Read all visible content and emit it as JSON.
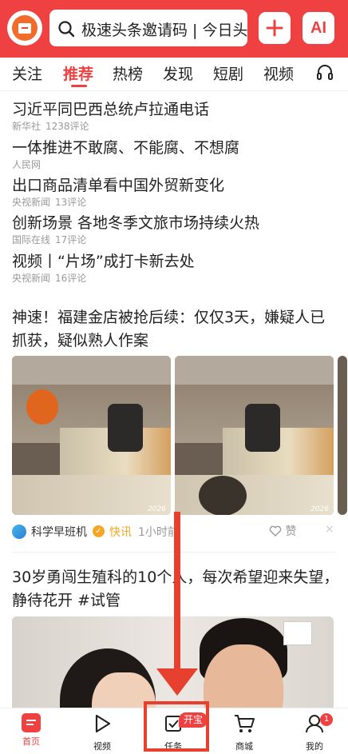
{
  "header": {
    "search_text": "极速头条邀请码 | 今日头",
    "ai_label": "AI"
  },
  "tabs": [
    "关注",
    "推荐",
    "热榜",
    "发现",
    "短剧",
    "视频"
  ],
  "active_tab": "推荐",
  "hot_list": [
    {
      "title": "习近平同巴西总统卢拉通电话",
      "source": "新华社",
      "comments": "1238评论"
    },
    {
      "title": "一体推进不敢腐、不能腐、不想腐",
      "source": "人民网",
      "comments": ""
    },
    {
      "title": "出口商品清单看中国外贸新变化",
      "source": "央视新闻",
      "comments": "13评论"
    },
    {
      "title": "创新场景 各地冬季文旅市场持续火热",
      "source": "国际在线",
      "comments": "17评论"
    },
    {
      "title": "视频丨“片场”成打卡新去处",
      "source": "央视新闻",
      "comments": "16评论"
    }
  ],
  "article1": {
    "title": "神速！福建金店被抢后续：仅仅3天，嫌疑人已抓获，疑似熟人作案",
    "image_stamp": "2026",
    "source": "科学早班机",
    "tag": "快讯",
    "time": "1小时前",
    "like_label": "赞",
    "close": "×"
  },
  "article2": {
    "title": "30岁勇闯生殖科的10个人，每次希望迎来失望，静待花开 #试管"
  },
  "bottom_nav": [
    {
      "label": "首页",
      "icon": "home-icon"
    },
    {
      "label": "视频",
      "icon": "play-icon"
    },
    {
      "label": "任务",
      "icon": "task-icon"
    },
    {
      "label": "商城",
      "icon": "cart-icon"
    },
    {
      "label": "我的",
      "icon": "user-icon"
    }
  ],
  "task_badge": "开宝",
  "profile_badge": "1",
  "colors": {
    "brand_red": "#f04142",
    "annotation_red": "#e8402f",
    "verify_orange": "#f5a623"
  }
}
